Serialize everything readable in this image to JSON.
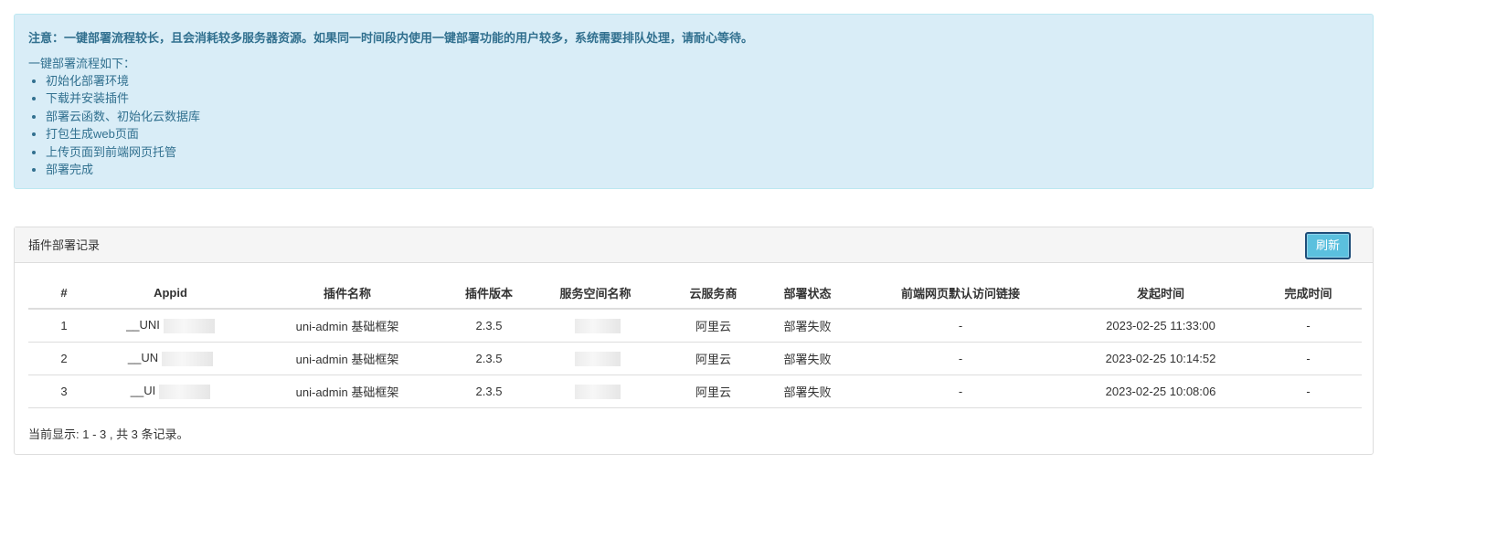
{
  "alert": {
    "notice": "注意：一键部署流程较长，且会消耗较多服务器资源。如果同一时间段内使用一键部署功能的用户较多，系统需要排队处理，请耐心等待。",
    "intro": "一键部署流程如下：",
    "steps": [
      "初始化部署环境",
      "下载并安装插件",
      "部署云函数、初始化云数据库",
      "打包生成web页面",
      "上传页面到前端网页托管",
      "部署完成"
    ]
  },
  "panel": {
    "title": "插件部署记录",
    "refresh_label": "刷新"
  },
  "table": {
    "headers": [
      "#",
      "Appid",
      "插件名称",
      "插件版本",
      "服务空间名称",
      "云服务商",
      "部署状态",
      "前端网页默认访问链接",
      "发起时间",
      "完成时间"
    ],
    "rows": [
      {
        "idx": "1",
        "appid": "__UNI",
        "plugin": "uni-admin 基础框架",
        "version": "2.3.5",
        "space": "",
        "provider": "阿里云",
        "status": "部署失败",
        "link": "-",
        "start": "2023-02-25 11:33:00",
        "end": "-"
      },
      {
        "idx": "2",
        "appid": "__UN",
        "plugin": "uni-admin 基础框架",
        "version": "2.3.5",
        "space": "",
        "provider": "阿里云",
        "status": "部署失败",
        "link": "-",
        "start": "2023-02-25 10:14:52",
        "end": "-"
      },
      {
        "idx": "3",
        "appid": "__UI",
        "plugin": "uni-admin 基础框架",
        "version": "2.3.5",
        "space": "",
        "provider": "阿里云",
        "status": "部署失败",
        "link": "-",
        "start": "2023-02-25 10:08:06",
        "end": "-"
      }
    ]
  },
  "footer": {
    "summary": "当前显示: 1 - 3 , 共 3 条记录。"
  },
  "colors": {
    "alert_bg": "#d9edf7",
    "alert_text": "#31708f",
    "button_bg": "#5bc0de"
  }
}
